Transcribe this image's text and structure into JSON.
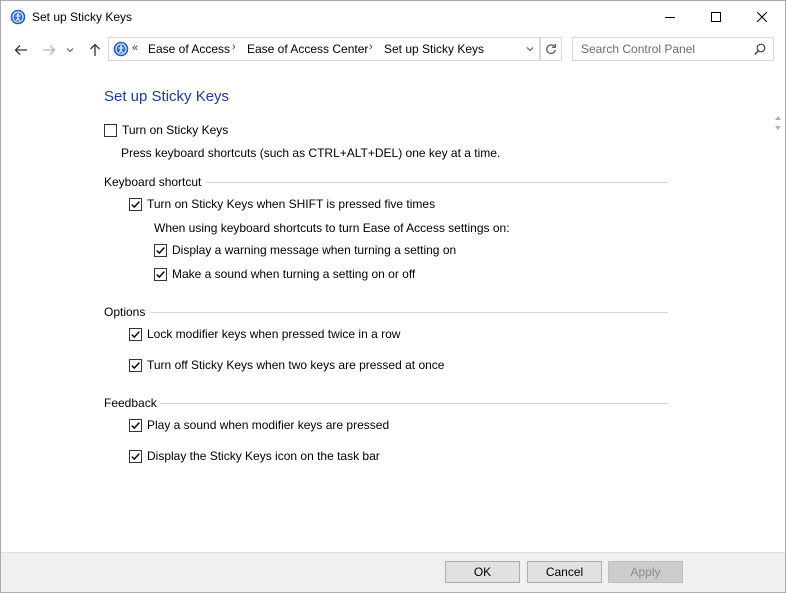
{
  "window": {
    "title": "Set up Sticky Keys",
    "controls": {
      "minimize": "minimize",
      "maximize": "maximize",
      "close": "close"
    }
  },
  "nav": {
    "address_prefix": "«",
    "breadcrumbs": [
      "Ease of Access",
      "Ease of Access Center",
      "Set up Sticky Keys"
    ],
    "separator": "›",
    "search_placeholder": "Search Control Panel"
  },
  "page": {
    "heading": "Set up Sticky Keys",
    "turn_on": {
      "label": "Turn on Sticky Keys",
      "checked": false
    },
    "turn_on_desc": "Press keyboard shortcuts (such as CTRL+ALT+DEL) one key at a time.",
    "keyboard_shortcut": {
      "title": "Keyboard shortcut",
      "shift_five": {
        "label": "Turn on Sticky Keys when SHIFT is pressed five times",
        "checked": true
      },
      "note": "When using keyboard shortcuts to turn Ease of Access settings on:",
      "warning": {
        "label": "Display a warning message when turning a setting on",
        "checked": true
      },
      "sound": {
        "label": "Make a sound when turning a setting on or off",
        "checked": true
      }
    },
    "options": {
      "title": "Options",
      "lock_modifier": {
        "label": "Lock modifier keys when pressed twice in a row",
        "checked": true
      },
      "turn_off_two": {
        "label": "Turn off Sticky Keys when two keys are pressed at once",
        "checked": true
      }
    },
    "feedback": {
      "title": "Feedback",
      "play_sound": {
        "label": "Play a sound when modifier keys are pressed",
        "checked": true
      },
      "taskbar_icon": {
        "label": "Display the Sticky Keys icon on the task bar",
        "checked": true
      }
    }
  },
  "footer": {
    "ok": "OK",
    "cancel": "Cancel",
    "apply": "Apply",
    "apply_enabled": false
  },
  "colors": {
    "heading": "#1e3d8f",
    "accent": "#0078d7"
  }
}
